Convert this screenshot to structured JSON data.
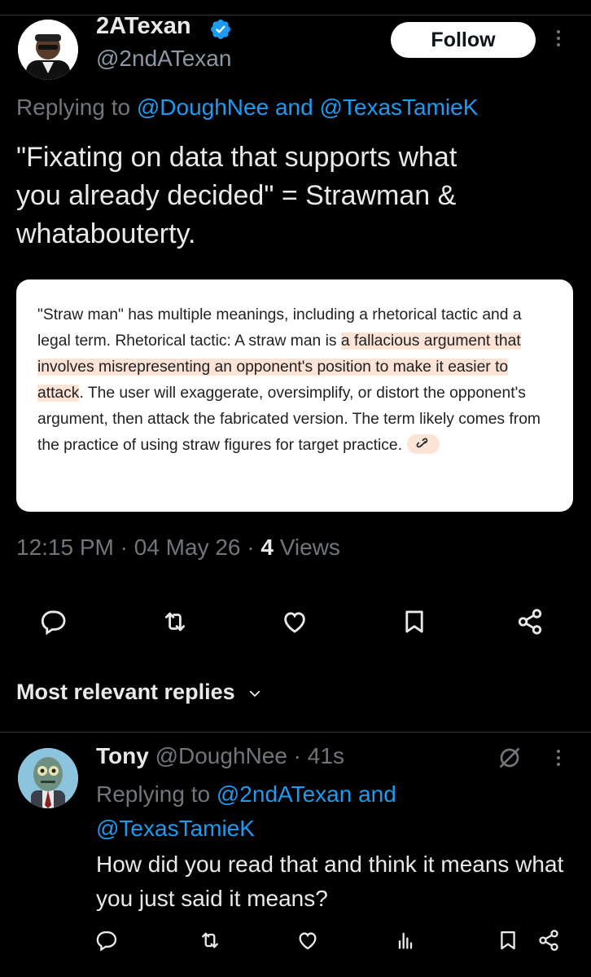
{
  "tweet": {
    "author_name": "2ATexan",
    "author_handle": "@2ndATexan",
    "follow_label": "Follow",
    "replying_prefix": "Replying to ",
    "replying_users": "@DoughNee and @TexasTamieK",
    "text": "\"Fixating on data that supports what\nyou already decided\" = Strawman &\nwhatabouterty.",
    "card": {
      "part1": "\"Straw man\" has multiple meanings, including a rhetorical tactic and a legal term. Rhetorical tactic: A straw man is ",
      "highlight": "a fallacious argument that involves misrepresenting an opponent's position to make it easier to attack",
      "part2": ". The user will exaggerate, oversimplify, or distort the opponent's argument, then attack the fabricated version. The term likely comes from the practice of using straw figures for target practice."
    },
    "time": "12:15 PM",
    "date": "04 May 26",
    "views_count": "4",
    "views_label": "Views"
  },
  "replies_header": "Most relevant replies",
  "reply": {
    "name": "Tony",
    "handle": "@DoughNee",
    "age": "41s",
    "replying_prefix": "Replying to ",
    "replying_users": "@2ndATexan and @TexasTamieK",
    "text": "How did you read that and think it means what you just said it means?"
  },
  "icons": {
    "verified": "verified-badge-icon",
    "reply": "reply-icon",
    "retweet": "retweet-icon",
    "like": "heart-icon",
    "bookmark": "bookmark-icon",
    "share": "share-icon",
    "analytics": "analytics-icon",
    "grok": "grok-icon",
    "chevron": "chevron-down-icon"
  },
  "colors": {
    "accent": "#1d9bf0",
    "muted": "#71767b",
    "highlight": "#fbe3d6"
  }
}
